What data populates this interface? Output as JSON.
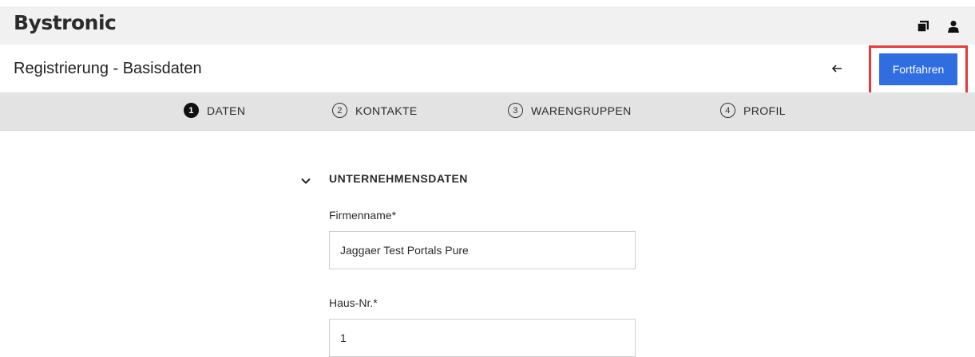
{
  "header": {
    "brand": "Bystronic",
    "icons": [
      "book-icon",
      "user-icon"
    ]
  },
  "titlebar": {
    "title": "Registrierung - Basisdaten",
    "back_icon": "arrow-left-icon",
    "continue_label": "Fortfahren"
  },
  "steps": [
    {
      "number": "1",
      "label": "DATEN",
      "active": true
    },
    {
      "number": "2",
      "label": "KONTAKTE",
      "active": false
    },
    {
      "number": "3",
      "label": "WARENGRUPPEN",
      "active": false
    },
    {
      "number": "4",
      "label": "PROFIL",
      "active": false
    }
  ],
  "section": {
    "title": "UNTERNEHMENSDATEN",
    "toggle_icon": "chevron-down-icon"
  },
  "fields": [
    {
      "label": "Firmenname*",
      "value": "Jaggaer Test Portals Pure"
    },
    {
      "label": "Haus-Nr.*",
      "value": "1"
    }
  ],
  "colors": {
    "accent": "#2f6de1",
    "highlight": "#e5393b",
    "brand_bar": "#f1f1f1",
    "steps_bar": "#e3e3e3"
  }
}
